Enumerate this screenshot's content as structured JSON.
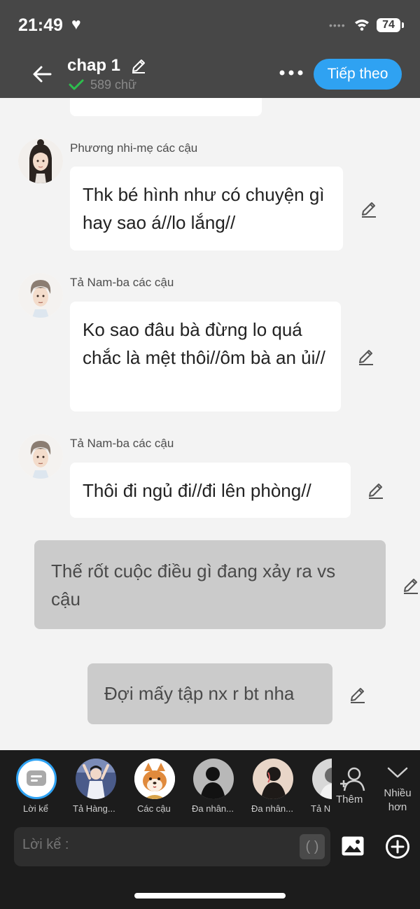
{
  "status_bar": {
    "time": "21:49",
    "heart": "♥",
    "dots": "••••",
    "battery": "74"
  },
  "header": {
    "title": "chap 1",
    "word_count": "589 chữ",
    "next_label": "Tiếp theo"
  },
  "messages": [
    {
      "speaker": "Phương nhi-mẹ các cậu",
      "text": "Thk bé hình như có chuyện gì hay sao á//lo lắng//"
    },
    {
      "speaker": "Tả Nam-ba các cậu",
      "text": "Ko sao đâu bà đừng lo quá chắc là mệt thôi//ôm bà an ủi//"
    },
    {
      "speaker": "Tả Nam-ba các cậu",
      "text": "Thôi đi ngủ đi//đi lên phòng//"
    },
    {
      "speaker": "",
      "text": "Thế rốt cuộc điều gì đang xảy ra vs cậu"
    },
    {
      "speaker": "",
      "text": "Đợi mấy tập nx r bt nha"
    }
  ],
  "characters": [
    {
      "label": "Lời kể"
    },
    {
      "label": "Tả Hàng..."
    },
    {
      "label": "Các cậu"
    },
    {
      "label": "Đa nhân..."
    },
    {
      "label": "Đa nhân..."
    },
    {
      "label": "Tả N"
    }
  ],
  "panel": {
    "add_label": "Thêm",
    "more_label": "Nhiều hơn",
    "input_placeholder": "Lời kể :",
    "paren_label": "( )"
  },
  "colors": {
    "topbar": "#474747",
    "accent": "#2fa2f2",
    "background": "#f3f3f3",
    "panel": "#1c1c1c"
  }
}
